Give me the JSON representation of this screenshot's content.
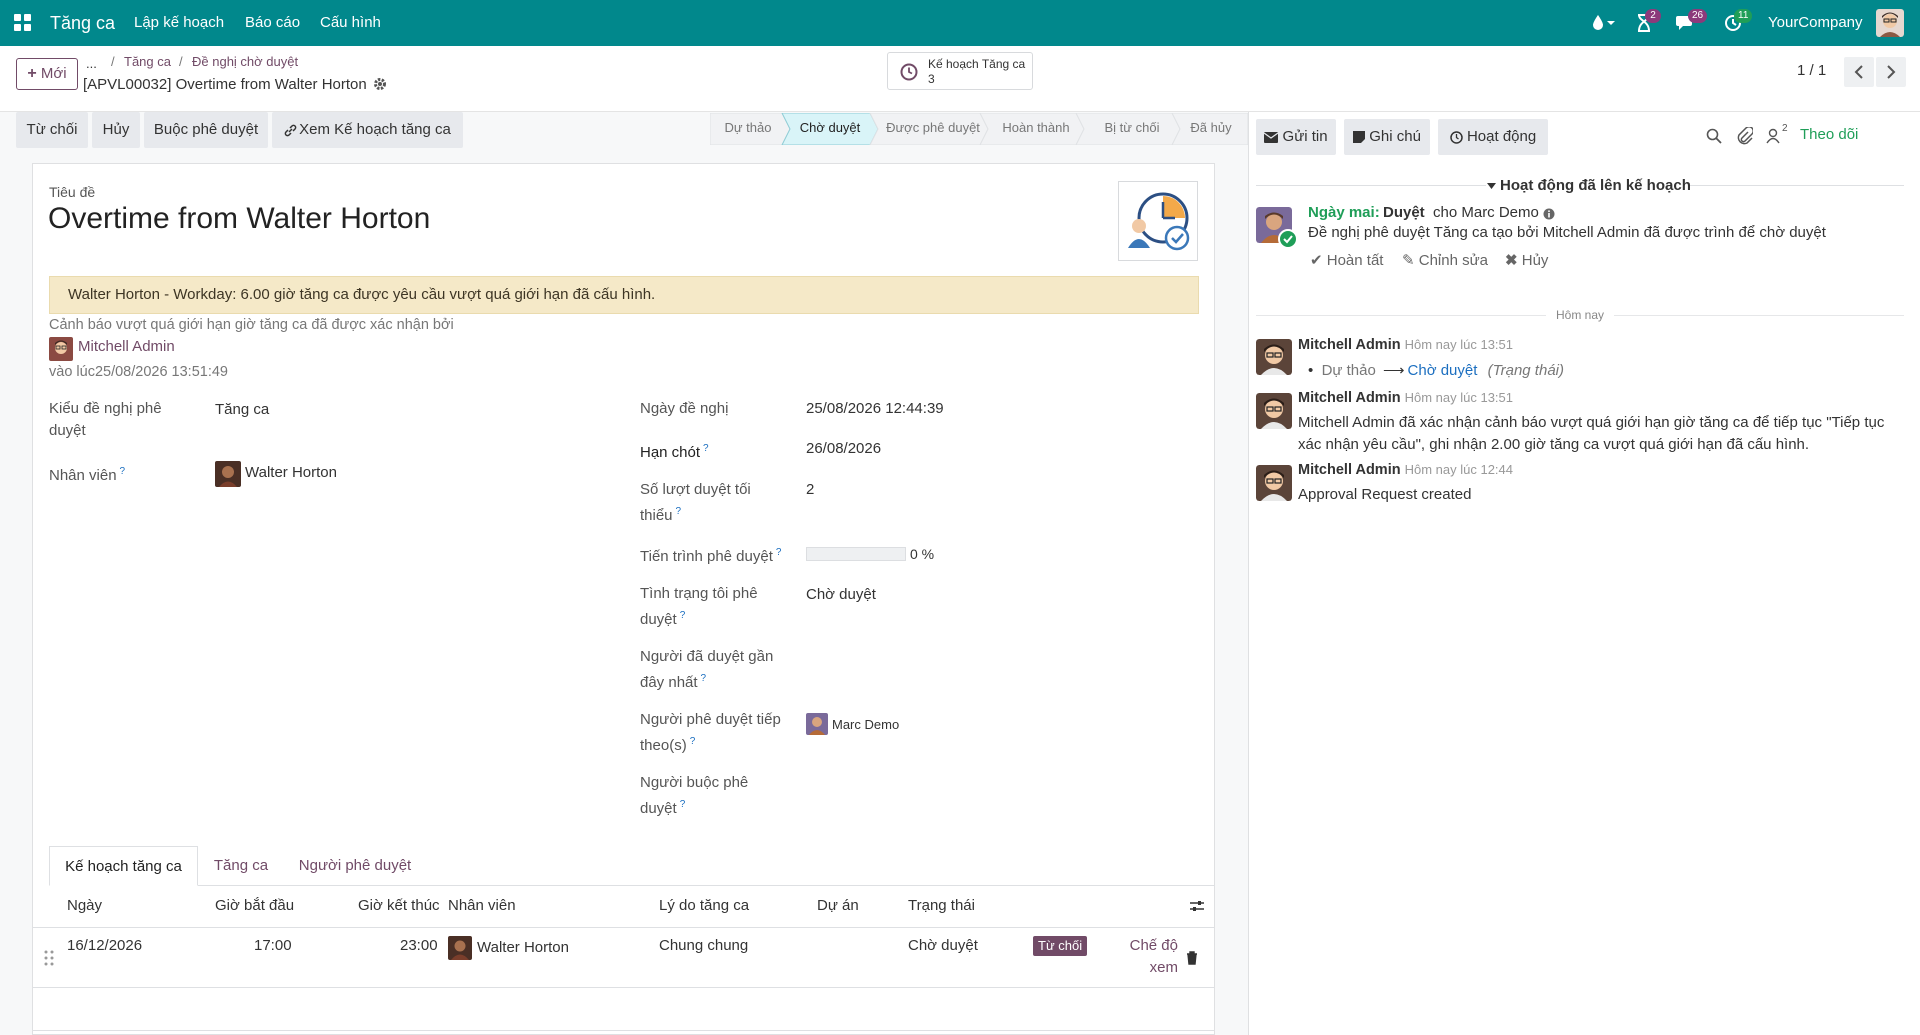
{
  "navbar": {
    "app_name": "Tăng ca",
    "menus": [
      "Lập kế hoạch",
      "Báo cáo",
      "Cấu hình"
    ],
    "badges": {
      "activity": "2",
      "messages": "26",
      "updates": "11"
    },
    "company": "YourCompany"
  },
  "control": {
    "new_button": "Mới",
    "breadcrumb": [
      "...",
      "Tăng ca",
      "Đề nghị chờ duyệt"
    ],
    "record_title": "[APVL00032] Overtime from Walter Horton",
    "smart_button": {
      "label": "Kế hoạch Tăng ca",
      "count": "3"
    },
    "pager": "1 / 1"
  },
  "actions": {
    "reject": "Từ chối",
    "cancel": "Hủy",
    "force_approve": "Buộc phê duyệt",
    "view_plan": "Xem Kế hoạch tăng ca"
  },
  "stages": [
    {
      "label": "Dự thảo",
      "active": false
    },
    {
      "label": "Chờ duyệt",
      "active": true
    },
    {
      "label": "Được phê duyệt",
      "active": false
    },
    {
      "label": "Hoàn thành",
      "active": false
    },
    {
      "label": "Bị từ chối",
      "active": false
    },
    {
      "label": "Đã hủy",
      "active": false
    }
  ],
  "form": {
    "title_label": "Tiêu đề",
    "title": "Overtime from Walter Horton",
    "alert": "Walter Horton - Workday: 6.00 giờ tăng ca được yêu cầu vượt quá giới hạn đã cấu hình.",
    "confirm_note": "Cảnh báo vượt quá giới hạn giờ tăng ca đã được xác nhận bởi",
    "confirmed_by": "Mitchell Admin",
    "confirmed_at": "vào lúc25/08/2026 13:51:49",
    "fields_left": {
      "request_type_label": "Kiểu đề nghị phê duyệt",
      "request_type": "Tăng ca",
      "employee_label": "Nhân viên",
      "employee": "Walter Horton"
    },
    "fields_right": {
      "request_date_label": "Ngày đề nghị",
      "request_date": "25/08/2026 12:44:39",
      "deadline_label": "Hạn chót",
      "deadline": "26/08/2026",
      "min_approvals_label": "Số lượt duyệt tối thiểu",
      "min_approvals": "2",
      "progress_label": "Tiến trình phê duyệt",
      "progress_value": 0,
      "progress_text": "0 %",
      "my_status_label": "Tình trạng tôi phê duyệt",
      "my_status": "Chờ duyệt",
      "last_approver_label": "Người đã duyệt gần đây nhất",
      "next_approver_label": "Người phê duyệt tiếp theo(s)",
      "next_approver": "Marc Demo",
      "forced_by_label": "Người buộc phê duyệt"
    },
    "tabs": [
      "Kế hoạch tăng ca",
      "Tăng ca",
      "Người phê duyệt"
    ],
    "table": {
      "headers": [
        "Ngày",
        "Giờ bắt đầu",
        "Giờ kết thúc",
        "Nhân viên",
        "Lý do tăng ca",
        "Dự án",
        "Trạng thái"
      ],
      "rows": [
        {
          "date": "16/12/2026",
          "start": "17:00",
          "end": "23:00",
          "employee": "Walter Horton",
          "reason": "Chung chung",
          "project": "",
          "status": "Chờ duyệt",
          "reject_badge": "Từ chối",
          "view_link": "Chế độ xem"
        }
      ]
    }
  },
  "chatter": {
    "send_message": "Gửi tin",
    "log_note": "Ghi chú",
    "activity": "Hoạt động",
    "follower_count": "2",
    "follow": "Theo dõi",
    "planned_header": "Hoạt động đã lên kế hoạch",
    "planned": {
      "when": "Ngày mai:",
      "type": "Duyệt",
      "for": "cho Marc Demo",
      "summary": "Đề nghị phê duyệt Tăng ca tạo bởi Mitchell Admin đã được trình để chờ duyệt",
      "done": "Hoàn tất",
      "edit": "Chỉnh sửa",
      "cancel": "Hủy"
    },
    "divider": "Hôm nay",
    "messages": [
      {
        "author": "Mitchell Admin",
        "time": "Hôm nay lúc 13:51",
        "tracking_from": "Dự thảo",
        "tracking_to": "Chờ duyệt",
        "tracking_field": "(Trạng thái)"
      },
      {
        "author": "Mitchell Admin",
        "time": "Hôm nay lúc 13:51",
        "body": "Mitchell Admin đã xác nhận cảnh báo vượt quá giới hạn giờ tăng ca để tiếp tục \"Tiếp tục xác nhận yêu cầu\", ghi nhận 2.00 giờ tăng ca vượt quá giới hạn đã cấu hình."
      },
      {
        "author": "Mitchell Admin",
        "time": "Hôm nay lúc 12:44",
        "body": "Approval Request created"
      }
    ]
  },
  "colors": {
    "navbar": "#01888c",
    "brand": "#714b67",
    "active_stage": "#d9f4f8",
    "link_blue": "#1c6fc0",
    "badge": "#8c3a7b",
    "green": "#1f9e58"
  }
}
